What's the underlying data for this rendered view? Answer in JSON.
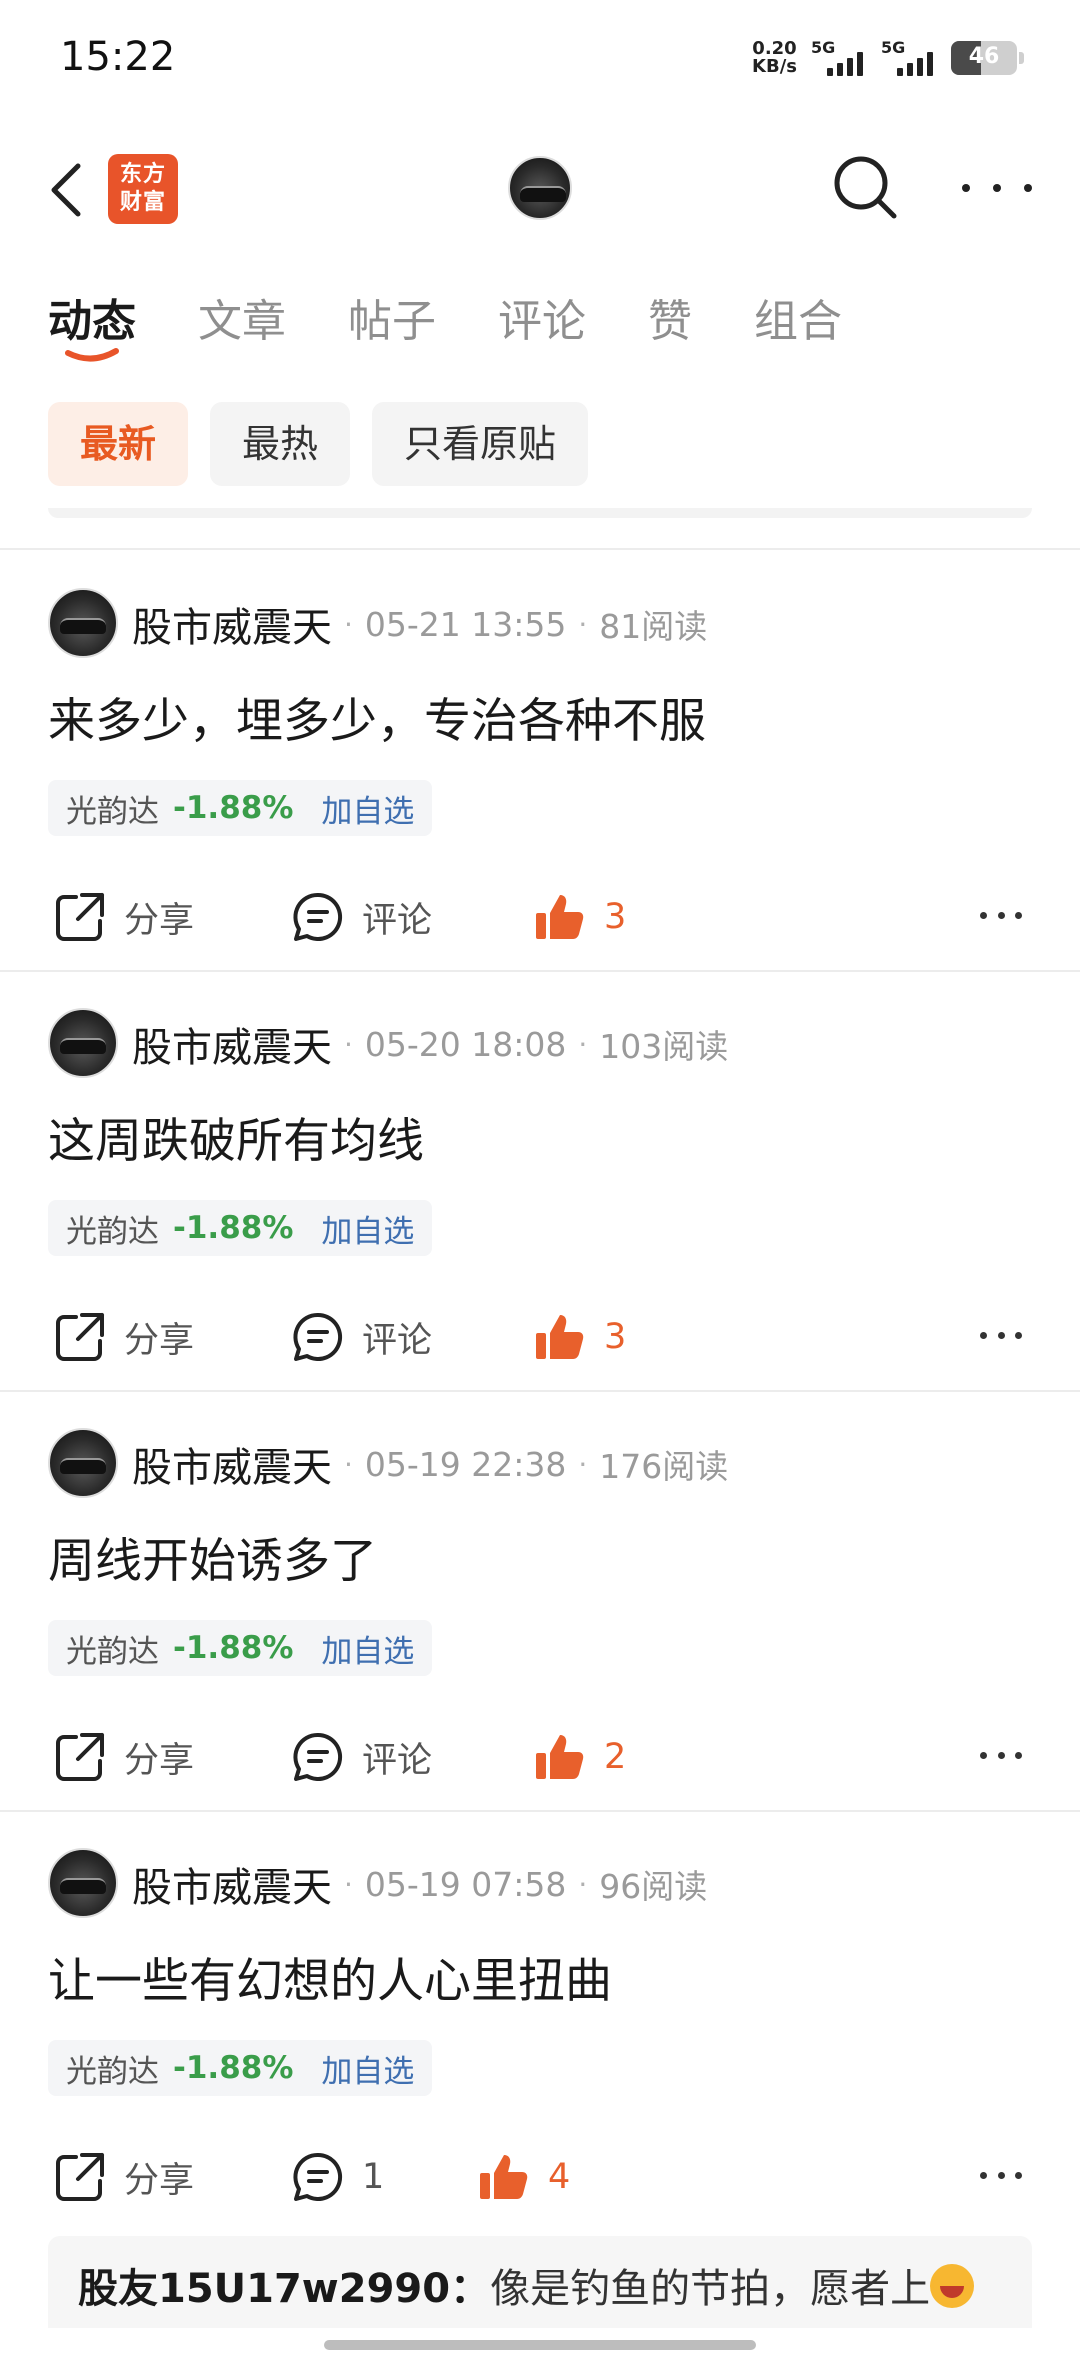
{
  "status_bar": {
    "time": "15:22",
    "net_speed_value": "0.20",
    "net_speed_unit": "KB/s",
    "signal1_label": "5G",
    "signal2_label": "5G",
    "battery_percent": "46",
    "battery_level": 0.46
  },
  "header": {
    "logo_text_line1": "东方",
    "logo_text_line2": "财富"
  },
  "tabs": [
    {
      "label": "动态"
    },
    {
      "label": "文章"
    },
    {
      "label": "帖子"
    },
    {
      "label": "评论"
    },
    {
      "label": "赞"
    },
    {
      "label": "组合"
    }
  ],
  "filters": [
    {
      "label": "最新"
    },
    {
      "label": "最热"
    },
    {
      "label": "只看原贴"
    }
  ],
  "posts": [
    {
      "author": "股市威震天",
      "time": "05-21 13:55",
      "reads": "81阅读",
      "content": "来多少，埋多少，专治各种不服",
      "stock": {
        "name": "光韵达",
        "change": "-1.88%",
        "add_label": "加自选"
      },
      "share_label": "分享",
      "comment_label": "评论",
      "likes": "3"
    },
    {
      "author": "股市威震天",
      "time": "05-20 18:08",
      "reads": "103阅读",
      "content": "这周跌破所有均线",
      "stock": {
        "name": "光韵达",
        "change": "-1.88%",
        "add_label": "加自选"
      },
      "share_label": "分享",
      "comment_label": "评论",
      "likes": "3"
    },
    {
      "author": "股市威震天",
      "time": "05-19 22:38",
      "reads": "176阅读",
      "content": "周线开始诱多了",
      "stock": {
        "name": "光韵达",
        "change": "-1.88%",
        "add_label": "加自选"
      },
      "share_label": "分享",
      "comment_label": "评论",
      "likes": "2"
    },
    {
      "author": "股市威震天",
      "time": "05-19 07:58",
      "reads": "96阅读",
      "content": "让一些有幻想的人心里扭曲",
      "stock": {
        "name": "光韵达",
        "change": "-1.88%",
        "add_label": "加自选"
      },
      "share_label": "分享",
      "comment_label": "1",
      "likes": "4"
    }
  ],
  "comment_preview": {
    "user": "股友15U17w2990：",
    "text": "像是钓鱼的节拍，愿者上"
  },
  "colors": {
    "accent": "#e8542a",
    "like": "#e8602c",
    "negative_change": "#3a9d4a",
    "link": "#3f6fb0"
  }
}
